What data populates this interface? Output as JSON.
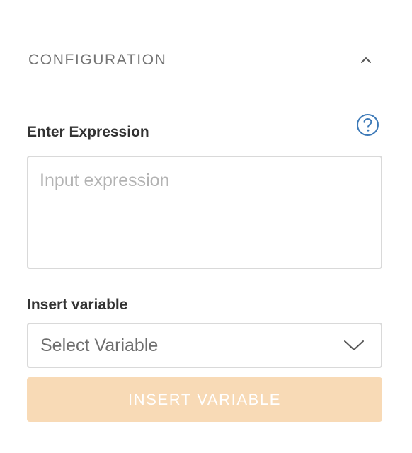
{
  "section": {
    "title": "CONFIGURATION",
    "toggle_icon": "chevron-up-icon"
  },
  "expression": {
    "label": "Enter Expression",
    "placeholder": "Input expression",
    "value": "",
    "help_icon": "help-circle-icon"
  },
  "variable": {
    "label": "Insert variable",
    "selected": "Select Variable",
    "dropdown_icon": "chevron-down-icon"
  },
  "insert_button": {
    "label": "INSERT VARIABLE",
    "disabled": true
  },
  "colors": {
    "accent_disabled": "#f8dab6",
    "help_icon": "#3d7ab8",
    "border": "#d9d9d9"
  }
}
